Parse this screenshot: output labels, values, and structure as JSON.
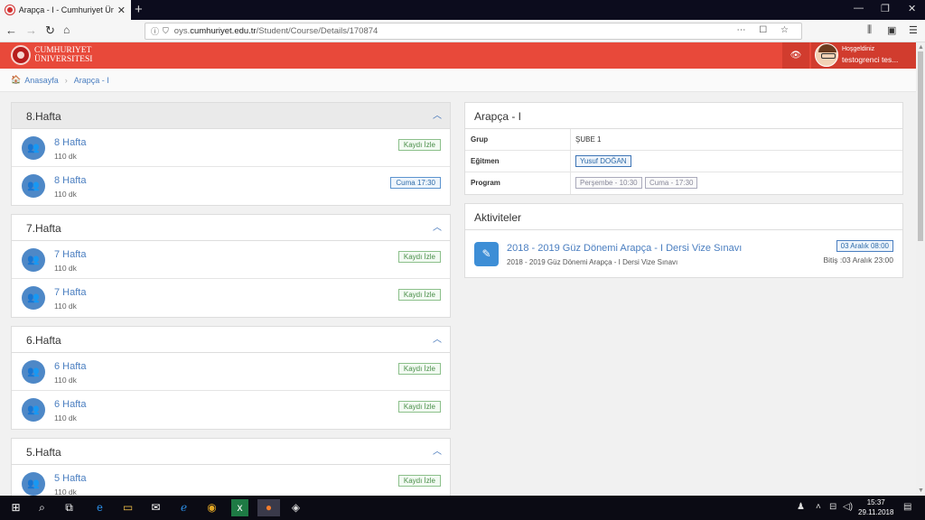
{
  "browser": {
    "tab_title": "Arapça - I - Cumhuriyet Üniver",
    "url_prefix": "oys.",
    "url_domain": "cumhuriyet.edu.tr",
    "url_path": "/Student/Course/Details/170874"
  },
  "header": {
    "university_line1": "CUMHURIYET",
    "university_line2": "ÜNIVERSITESI",
    "welcome": "Hoşgeldiniz",
    "username": "testogrenci tes..."
  },
  "breadcrumb": {
    "home": "Anasayfa",
    "current": "Arapça - I"
  },
  "weeks": [
    {
      "title": "8.Hafta",
      "lessons": [
        {
          "title": "8 Hafta",
          "duration": "110 dk",
          "badge": "Kaydı İzle"
        },
        {
          "title": "8 Hafta",
          "duration": "110 dk",
          "badge": "Cuma 17:30"
        }
      ]
    },
    {
      "title": "7.Hafta",
      "lessons": [
        {
          "title": "7 Hafta",
          "duration": "110 dk",
          "badge": "Kaydı İzle"
        },
        {
          "title": "7 Hafta",
          "duration": "110 dk",
          "badge": "Kaydı İzle"
        }
      ]
    },
    {
      "title": "6.Hafta",
      "lessons": [
        {
          "title": "6 Hafta",
          "duration": "110 dk",
          "badge": "Kaydı İzle"
        },
        {
          "title": "6 Hafta",
          "duration": "110 dk",
          "badge": "Kaydı İzle"
        }
      ]
    },
    {
      "title": "5.Hafta",
      "lessons": [
        {
          "title": "5 Hafta",
          "duration": "110 dk",
          "badge": "Kaydı İzle"
        }
      ]
    }
  ],
  "course": {
    "title": "Arapça - I",
    "group_label": "Grup",
    "group_value": "ŞUBE 1",
    "teacher_label": "Eğitmen",
    "teacher_value": "Yusuf DOĞAN",
    "program_label": "Program",
    "program_1": "Perşembe - 10:30",
    "program_2": "Cuma - 17:30"
  },
  "activities": {
    "title": "Aktiviteler",
    "item_title": "2018 - 2019 Güz Dönemi Arapça - I Dersi Vize Sınavı",
    "item_sub": "2018 - 2019 Güz Dönemi Arapça - I Dersi Vize Sınavı",
    "item_date": "03 Aralık 08:00",
    "item_end": "Bitiş :03 Aralık 23:00"
  },
  "taskbar": {
    "time": "15:37",
    "date": "29.11.2018"
  }
}
